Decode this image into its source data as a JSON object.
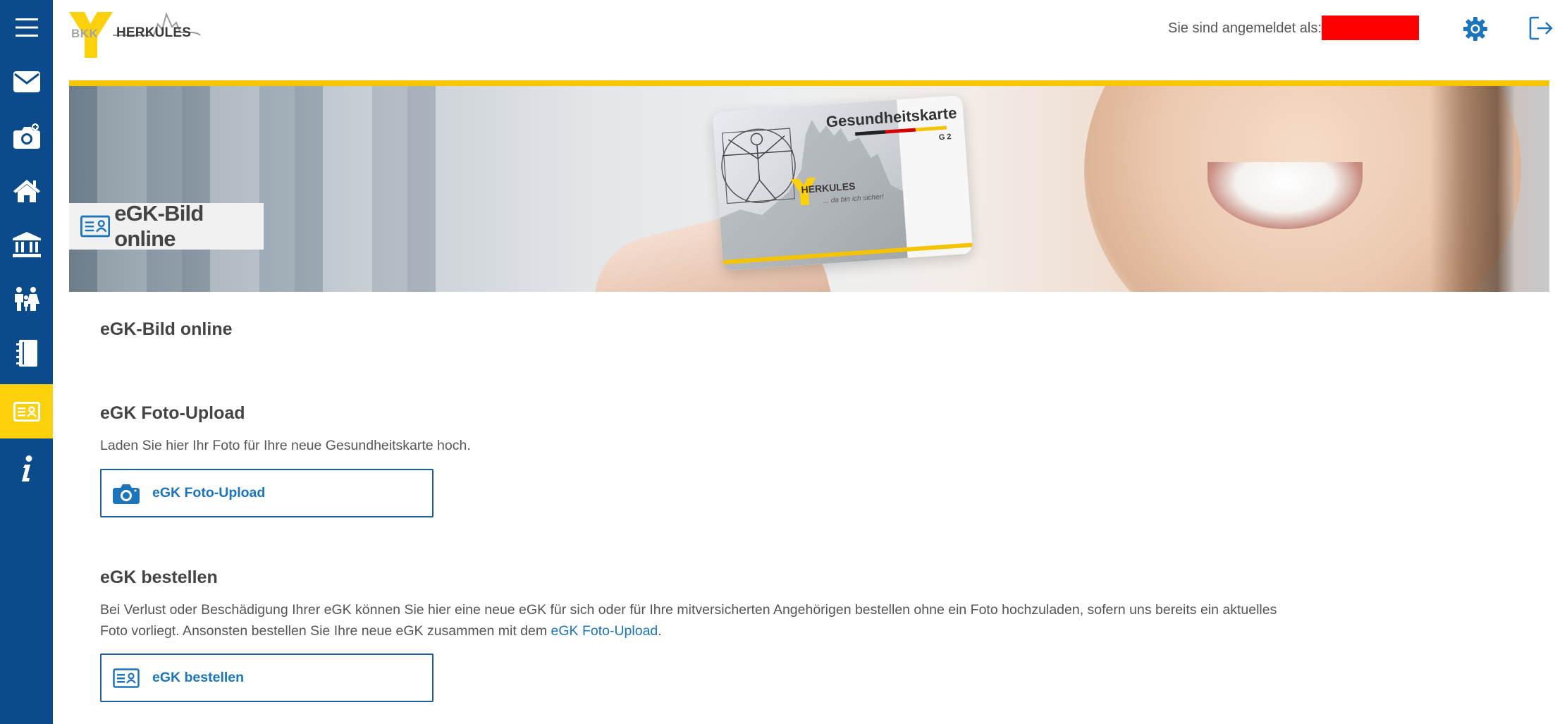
{
  "header": {
    "logo_bkk": "BKK",
    "logo_name": "HERKULES",
    "login_label": "Sie sind angemeldet als:"
  },
  "sidebar": {
    "items": [
      {
        "icon": "menu-icon"
      },
      {
        "icon": "mail-icon"
      },
      {
        "icon": "camera-icon"
      },
      {
        "icon": "home-icon"
      },
      {
        "icon": "bank-icon"
      },
      {
        "icon": "family-icon"
      },
      {
        "icon": "notebook-icon"
      },
      {
        "icon": "id-card-icon",
        "active": true
      },
      {
        "icon": "info-icon"
      }
    ]
  },
  "banner": {
    "label": "eGK-Bild online",
    "card_title": "Gesundheitskarte",
    "card_g2": "G 2",
    "card_brand": "HERKULES",
    "card_tagline": "... da bin ich sicher!"
  },
  "main": {
    "page_title": "eGK-Bild online",
    "upload": {
      "title": "eGK Foto-Upload",
      "text": "Laden Sie hier Ihr Foto für Ihre neue Gesundheitskarte hoch.",
      "button": "eGK Foto-Upload"
    },
    "order": {
      "title": "eGK bestellen",
      "text_part1": "Bei Verlust oder Beschädigung Ihrer eGK können Sie hier eine neue eGK für sich oder für Ihre mitversicherten Angehörigen bestellen ohne ein Foto hochzuladen, sofern uns bereits ein aktuelles Foto vorliegt. Ansonsten bestellen Sie Ihre neue eGK zusammen mit dem ",
      "text_link": "eGK Foto-Upload",
      "text_part2": ".",
      "button": "eGK bestellen"
    }
  },
  "colors": {
    "sidebar": "#0b4a8b",
    "accent_yellow": "#fcd00a",
    "link_blue": "#1c74bb",
    "redaction": "#ff0000"
  }
}
